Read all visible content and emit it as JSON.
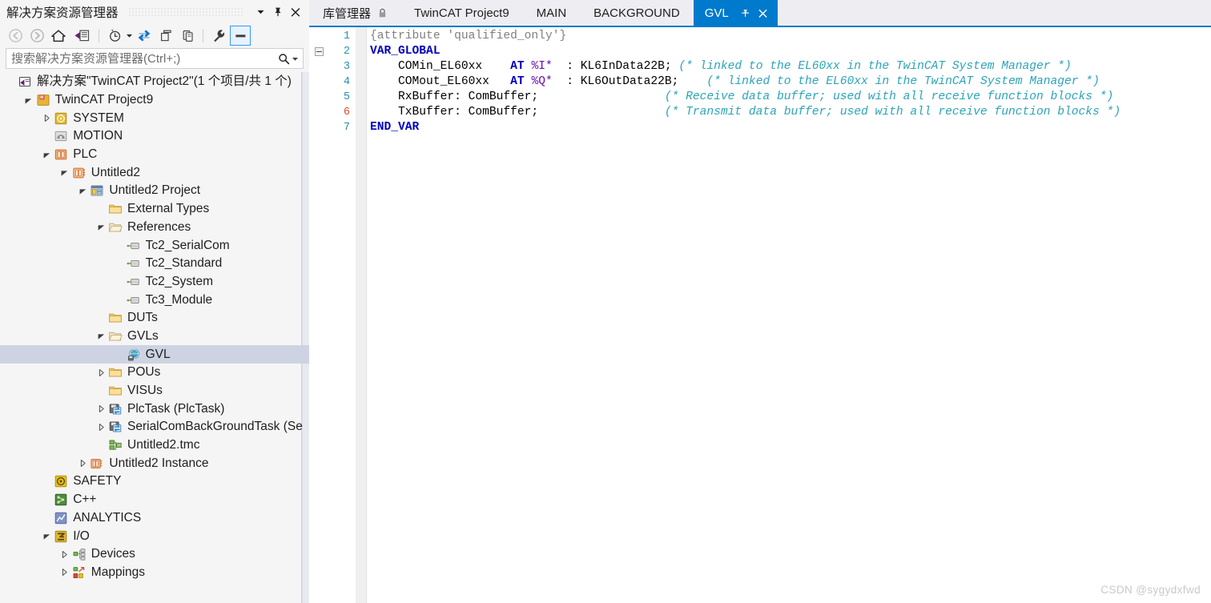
{
  "solution_explorer": {
    "title": "解决方案资源管理器",
    "header_buttons": [
      {
        "name": "dropdown-icon",
        "glyph": "▼"
      },
      {
        "name": "pin-icon",
        "glyph": "pin"
      },
      {
        "name": "close-icon",
        "glyph": "✕"
      }
    ],
    "toolbar": [
      {
        "name": "back-button",
        "tip": "Back"
      },
      {
        "name": "forward-button",
        "tip": "Forward"
      },
      {
        "name": "home-button",
        "tip": "Home"
      },
      {
        "name": "solution-explorer-button",
        "tip": "Solution Explorer"
      },
      {
        "name": "pending-changes-button",
        "tip": "Pending Changes"
      },
      {
        "name": "pending-changes-dropdown",
        "tip": "Pending Changes Options"
      },
      {
        "name": "sync-button",
        "tip": "Sync with Active Document"
      },
      {
        "name": "show-all-files-button",
        "tip": "Show All Files"
      },
      {
        "name": "refresh-button",
        "tip": "Refresh"
      },
      {
        "name": "properties-button",
        "tip": "Properties"
      },
      {
        "name": "preview-selected-items-button",
        "tip": "Preview Selected Items"
      }
    ],
    "search": {
      "placeholder": "搜索解决方案资源管理器(Ctrl+;)",
      "value": ""
    },
    "tree": [
      {
        "label": "解决方案\"TwinCAT Project2\"(1 个项目/共 1 个)",
        "indent": 0,
        "twisty": "none",
        "icon": "solution-icon",
        "selected": false
      },
      {
        "label": "TwinCAT Project9",
        "indent": 1,
        "twisty": "open",
        "icon": "project-icon",
        "selected": false
      },
      {
        "label": "SYSTEM",
        "indent": 2,
        "twisty": "closed",
        "icon": "system-icon",
        "selected": false
      },
      {
        "label": "MOTION",
        "indent": 2,
        "twisty": "none",
        "icon": "motion-icon",
        "selected": false
      },
      {
        "label": "PLC",
        "indent": 2,
        "twisty": "open",
        "icon": "plc-icon",
        "selected": false
      },
      {
        "label": "Untitled2",
        "indent": 3,
        "twisty": "open",
        "icon": "plc-project-icon",
        "selected": false
      },
      {
        "label": "Untitled2 Project",
        "indent": 4,
        "twisty": "open",
        "icon": "plc-app-icon",
        "selected": false
      },
      {
        "label": "External Types",
        "indent": 5,
        "twisty": "none",
        "icon": "folder-icon",
        "selected": false
      },
      {
        "label": "References",
        "indent": 5,
        "twisty": "open",
        "icon": "folder-open-icon",
        "selected": false
      },
      {
        "label": "Tc2_SerialCom",
        "indent": 6,
        "twisty": "none",
        "icon": "library-icon",
        "selected": false
      },
      {
        "label": "Tc2_Standard",
        "indent": 6,
        "twisty": "none",
        "icon": "library-icon",
        "selected": false
      },
      {
        "label": "Tc2_System",
        "indent": 6,
        "twisty": "none",
        "icon": "library-icon",
        "selected": false
      },
      {
        "label": "Tc3_Module",
        "indent": 6,
        "twisty": "none",
        "icon": "library-icon",
        "selected": false
      },
      {
        "label": "DUTs",
        "indent": 5,
        "twisty": "none",
        "icon": "folder-icon",
        "selected": false
      },
      {
        "label": "GVLs",
        "indent": 5,
        "twisty": "open",
        "icon": "folder-open-icon",
        "selected": false
      },
      {
        "label": "GVL",
        "indent": 6,
        "twisty": "none",
        "icon": "gvl-icon",
        "selected": true
      },
      {
        "label": "POUs",
        "indent": 5,
        "twisty": "closed",
        "icon": "folder-icon",
        "selected": false
      },
      {
        "label": "VISUs",
        "indent": 5,
        "twisty": "none",
        "icon": "folder-icon",
        "selected": false
      },
      {
        "label": "PlcTask (PlcTask)",
        "indent": 5,
        "twisty": "closed",
        "icon": "task-icon",
        "selected": false
      },
      {
        "label": "SerialComBackGroundTask (Se",
        "indent": 5,
        "twisty": "closed",
        "icon": "task-icon",
        "selected": false
      },
      {
        "label": "Untitled2.tmc",
        "indent": 5,
        "twisty": "none",
        "icon": "tmc-icon",
        "selected": false
      },
      {
        "label": "Untitled2 Instance",
        "indent": 4,
        "twisty": "closed",
        "icon": "plc-instance-icon",
        "selected": false
      },
      {
        "label": "SAFETY",
        "indent": 2,
        "twisty": "none",
        "icon": "safety-icon",
        "selected": false
      },
      {
        "label": "C++",
        "indent": 2,
        "twisty": "none",
        "icon": "cpp-icon",
        "selected": false
      },
      {
        "label": "ANALYTICS",
        "indent": 2,
        "twisty": "none",
        "icon": "analytics-icon",
        "selected": false
      },
      {
        "label": "I/O",
        "indent": 2,
        "twisty": "open",
        "icon": "io-icon",
        "selected": false
      },
      {
        "label": "Devices",
        "indent": 3,
        "twisty": "closed",
        "icon": "devices-icon",
        "selected": false
      },
      {
        "label": "Mappings",
        "indent": 3,
        "twisty": "closed",
        "icon": "mappings-icon",
        "selected": false
      }
    ]
  },
  "editor": {
    "tabs": [
      {
        "label": "库管理器",
        "active": false,
        "pinned": true
      },
      {
        "label": "TwinCAT Project9",
        "active": false,
        "pinned": false
      },
      {
        "label": "MAIN",
        "active": false,
        "pinned": false
      },
      {
        "label": "BACKGROUND",
        "active": false,
        "pinned": false
      },
      {
        "label": "GVL",
        "active": true,
        "pinned": false
      }
    ],
    "active_tab_color": "#007acc",
    "line_numbers": [
      "1",
      "2",
      "3",
      "4",
      "5",
      "6",
      "7"
    ],
    "modified_lines": [
      "6"
    ],
    "fold_line": "2",
    "code_lines": [
      [
        {
          "t": "{attribute 'qualified_only'}",
          "c": "k-attr"
        }
      ],
      [
        {
          "t": "VAR_GLOBAL",
          "c": "k-kw"
        }
      ],
      [
        {
          "t": "    COMin_EL60xx    ",
          "c": "k-plain"
        },
        {
          "t": "AT ",
          "c": "k-at"
        },
        {
          "t": "%I*",
          "c": "k-addr"
        },
        {
          "t": "  : KL6InData22B; ",
          "c": "k-plain"
        },
        {
          "t": "(* linked to the EL60xx in the TwinCAT System Manager *)",
          "c": "k-cmt"
        }
      ],
      [
        {
          "t": "    COMout_EL60xx   ",
          "c": "k-plain"
        },
        {
          "t": "AT ",
          "c": "k-at"
        },
        {
          "t": "%Q*",
          "c": "k-addr"
        },
        {
          "t": "  : KL6OutData22B;    ",
          "c": "k-plain"
        },
        {
          "t": "(* linked to the EL60xx in the TwinCAT System Manager *)",
          "c": "k-cmt"
        }
      ],
      [
        {
          "t": "    RxBuffer: ComBuffer;                  ",
          "c": "k-plain"
        },
        {
          "t": "(* Receive data buffer; used with all receive function blocks *)",
          "c": "k-cmt"
        }
      ],
      [
        {
          "t": "    TxBuffer: ComBuffer;                  ",
          "c": "k-plain"
        },
        {
          "t": "(* Transmit data buffer; used with all receive function blocks *)",
          "c": "k-cmt"
        }
      ],
      [
        {
          "t": "END_VAR",
          "c": "k-kw"
        }
      ]
    ]
  },
  "watermark": "CSDN @sygydxfwd"
}
